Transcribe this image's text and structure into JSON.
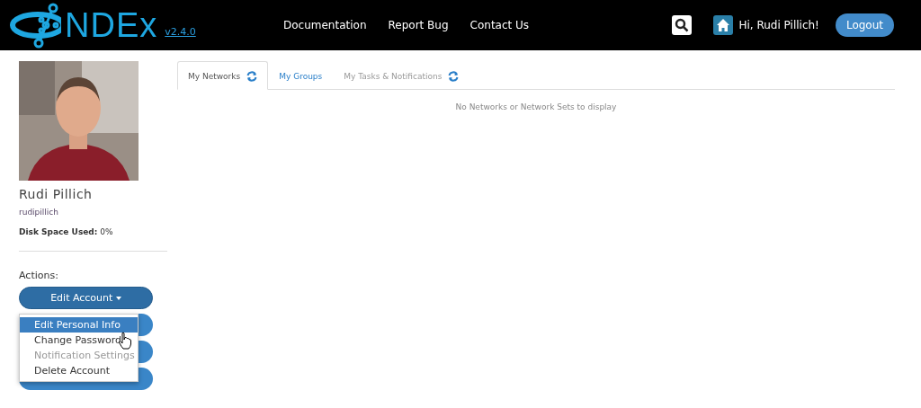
{
  "header": {
    "logo": "NDEx",
    "version": "v2.4.0",
    "nav": [
      "Documentation",
      "Report Bug",
      "Contact Us"
    ],
    "greeting": "Hi, Rudi Pillich!",
    "logout": "Logout"
  },
  "profile": {
    "name": "Rudi Pillich",
    "username": "rudipillich",
    "disk_label": "Disk Space Used:",
    "disk_value": "0%"
  },
  "actions": {
    "title": "Actions:",
    "buttons": [
      {
        "kind": "dropdown",
        "label": "Edit Account"
      },
      {
        "kind": "covered"
      },
      {
        "kind": "covered"
      },
      {
        "kind": "covered"
      }
    ],
    "menu": [
      {
        "label": "Edit Personal Info",
        "selected": true,
        "disabled": false
      },
      {
        "label": "Change Password",
        "selected": false,
        "disabled": false
      },
      {
        "label": "Notification Settings",
        "selected": false,
        "disabled": true
      },
      {
        "label": "Delete Account",
        "selected": false,
        "disabled": false
      }
    ]
  },
  "tabs": [
    {
      "label": "My Networks",
      "selected": true,
      "refresh": true,
      "disabled": false
    },
    {
      "label": "My Groups",
      "selected": false,
      "refresh": false,
      "disabled": false
    },
    {
      "label": "My Tasks & Notifications",
      "selected": false,
      "refresh": true,
      "disabled": true
    }
  ],
  "empty_message": "No Networks or Network Sets to display"
}
